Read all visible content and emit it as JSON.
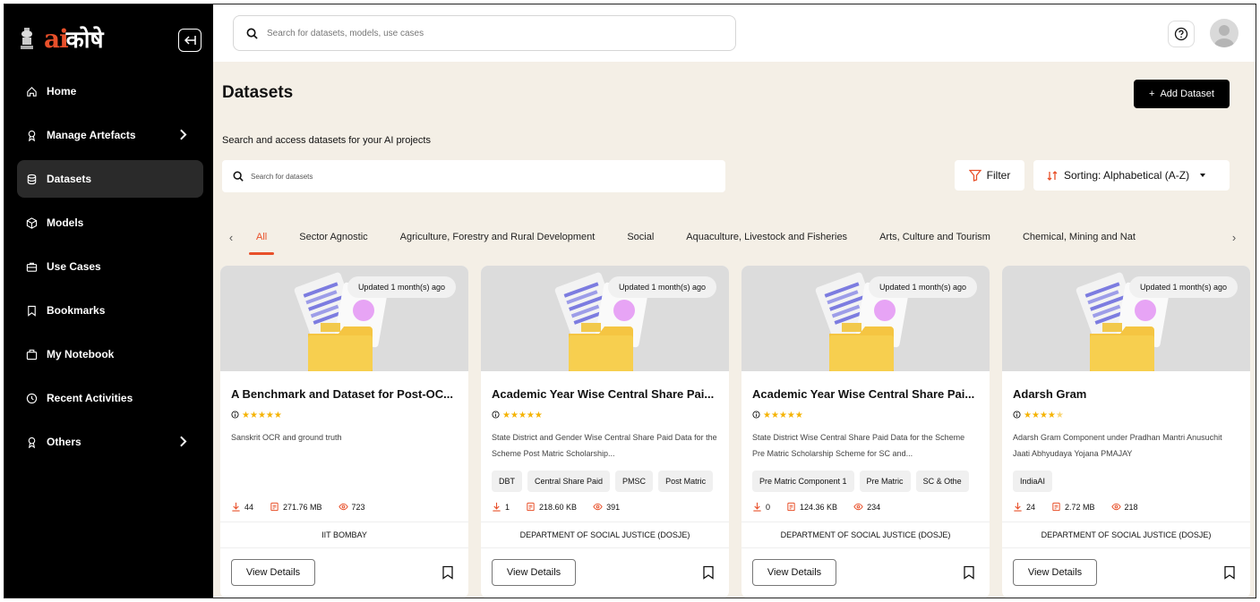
{
  "brand": {
    "logo_ai": "ai",
    "logo_rest": "कोषे"
  },
  "sidebar": {
    "items": [
      {
        "label": "Home",
        "icon": "home-icon"
      },
      {
        "label": "Manage Artefacts",
        "icon": "award-icon",
        "has_chevron": true
      },
      {
        "label": "Datasets",
        "icon": "database-icon",
        "active": true
      },
      {
        "label": "Models",
        "icon": "cube-icon"
      },
      {
        "label": "Use Cases",
        "icon": "briefcase-icon"
      },
      {
        "label": "Bookmarks",
        "icon": "bookmark-icon"
      },
      {
        "label": "My Notebook",
        "icon": "notebook-icon"
      },
      {
        "label": "Recent Activities",
        "icon": "clock-icon"
      },
      {
        "label": "Others",
        "icon": "award-icon",
        "has_chevron": true
      }
    ]
  },
  "topbar": {
    "search_placeholder": "Search for datasets, models, use cases"
  },
  "header": {
    "title": "Datasets",
    "add_label": "Add Dataset",
    "subtitle": "Search and access datasets for your AI projects",
    "search_placeholder": "Search for datasets",
    "filter_label": "Filter",
    "sort_label": "Sorting: Alphabetical (A-Z)"
  },
  "tabs": [
    "All",
    "Sector Agnostic",
    "Agriculture, Forestry and Rural Development",
    "Social",
    "Aquaculture, Livestock and Fisheries",
    "Arts, Culture and Tourism",
    "Chemical, Mining and Nat"
  ],
  "cards": [
    {
      "updated": "Updated 1 month(s) ago",
      "title": "A Benchmark and Dataset for Post-OC...",
      "desc": "Sanskrit OCR and ground truth",
      "tags": [],
      "downloads": "44",
      "size": "271.76 MB",
      "views": "723",
      "org": "IIT BOMBAY",
      "stars": 5
    },
    {
      "updated": "Updated 1 month(s) ago",
      "title": "Academic Year Wise Central Share Pai...",
      "desc": "State District and Gender Wise Central Share Paid Data for the Scheme Post Matric Scholarship...",
      "tags": [
        "DBT",
        "Central Share Paid",
        "PMSC",
        "Post Matric"
      ],
      "downloads": "1",
      "size": "218.60 KB",
      "views": "391",
      "org": "DEPARTMENT OF SOCIAL JUSTICE (DOSJE)",
      "stars": 5
    },
    {
      "updated": "Updated 1 month(s) ago",
      "title": "Academic Year Wise Central Share Pai...",
      "desc": "State District Wise Central Share Paid Data for the Scheme Pre Matric Scholarship Scheme for SC and...",
      "tags": [
        "Pre Matric Component 1",
        "Pre Matric",
        "SC & Othe"
      ],
      "downloads": "0",
      "size": "124.36 KB",
      "views": "234",
      "org": "DEPARTMENT OF SOCIAL JUSTICE (DOSJE)",
      "stars": 5
    },
    {
      "updated": "Updated 1 month(s) ago",
      "title": "Adarsh Gram",
      "desc": "Adarsh Gram Component under Pradhan Mantri Anusuchit Jaati Abhyudaya Yojana PMAJAY",
      "tags": [
        "IndiaAI"
      ],
      "downloads": "24",
      "size": "2.72 MB",
      "views": "218",
      "org": "DEPARTMENT OF SOCIAL JUSTICE (DOSJE)",
      "stars": 4.5
    }
  ],
  "view_details_label": "View Details",
  "colors": {
    "accent": "#e8502a",
    "star": "#f5b301",
    "page_bg": "#f4efe6",
    "sidebar_bg": "#000000"
  }
}
